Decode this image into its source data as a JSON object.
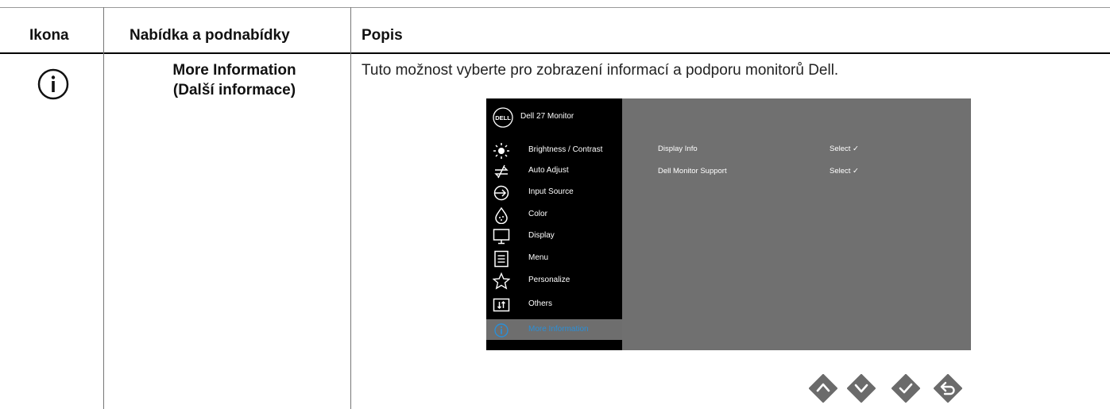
{
  "table": {
    "headers": [
      "Ikona",
      "Nabídka a podnabídky",
      "Popis"
    ],
    "row": {
      "icon": "info-circle-icon",
      "menu_line1": "More Information",
      "menu_line2": "(Další informace)",
      "description": "Tuto možnost vyberte pro zobrazení informací a podporu monitorů Dell."
    }
  },
  "osd": {
    "title": "Dell 27 Monitor",
    "menu": [
      {
        "label": "Brightness / Contrast",
        "icon": "brightness-icon"
      },
      {
        "label": "Auto Adjust",
        "icon": "auto-adjust-icon"
      },
      {
        "label": "Input Source",
        "icon": "input-source-icon"
      },
      {
        "label": "Color",
        "icon": "color-icon"
      },
      {
        "label": "Display",
        "icon": "display-icon"
      },
      {
        "label": "Menu",
        "icon": "menu-icon"
      },
      {
        "label": "Personalize",
        "icon": "star-icon"
      },
      {
        "label": "Others",
        "icon": "others-icon"
      },
      {
        "label": "More Information",
        "icon": "info-icon",
        "active": true
      }
    ],
    "rows": [
      {
        "label": "Display Info",
        "value": "Select ✓"
      },
      {
        "label": "Dell Monitor Support",
        "value": "Select ✓"
      }
    ]
  },
  "nav_buttons": [
    "up-button",
    "down-button",
    "check-button",
    "back-button"
  ],
  "colors": {
    "osd_panel": "#707070",
    "osd_sidebar": "#000000",
    "active_text": "#2a8fd8",
    "nav_button": "#6b6b6b"
  }
}
